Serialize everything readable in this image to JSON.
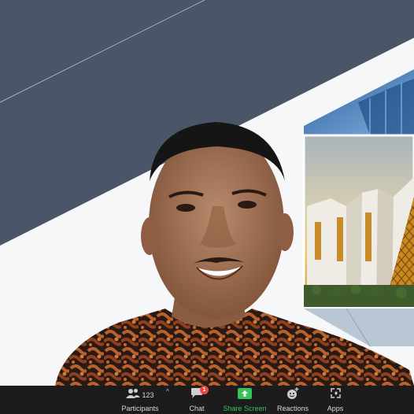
{
  "meeting": {
    "participant_count": "123",
    "chat_unread": "1"
  },
  "toolbar": {
    "participants_label": "Participants",
    "chat_label": "Chat",
    "share_label": "Share Screen",
    "reactions_label": "Reactions",
    "apps_label": "Apps"
  },
  "icons": {
    "participants": "participants-icon",
    "chat": "chat-icon",
    "share": "share-screen-icon",
    "reactions": "reactions-icon",
    "apps": "apps-icon"
  },
  "colors": {
    "toolbar_bg": "#1c1c1c",
    "share_green": "#35c25a",
    "badge_red": "#e8493f",
    "slate_panel": "#4a5568"
  }
}
